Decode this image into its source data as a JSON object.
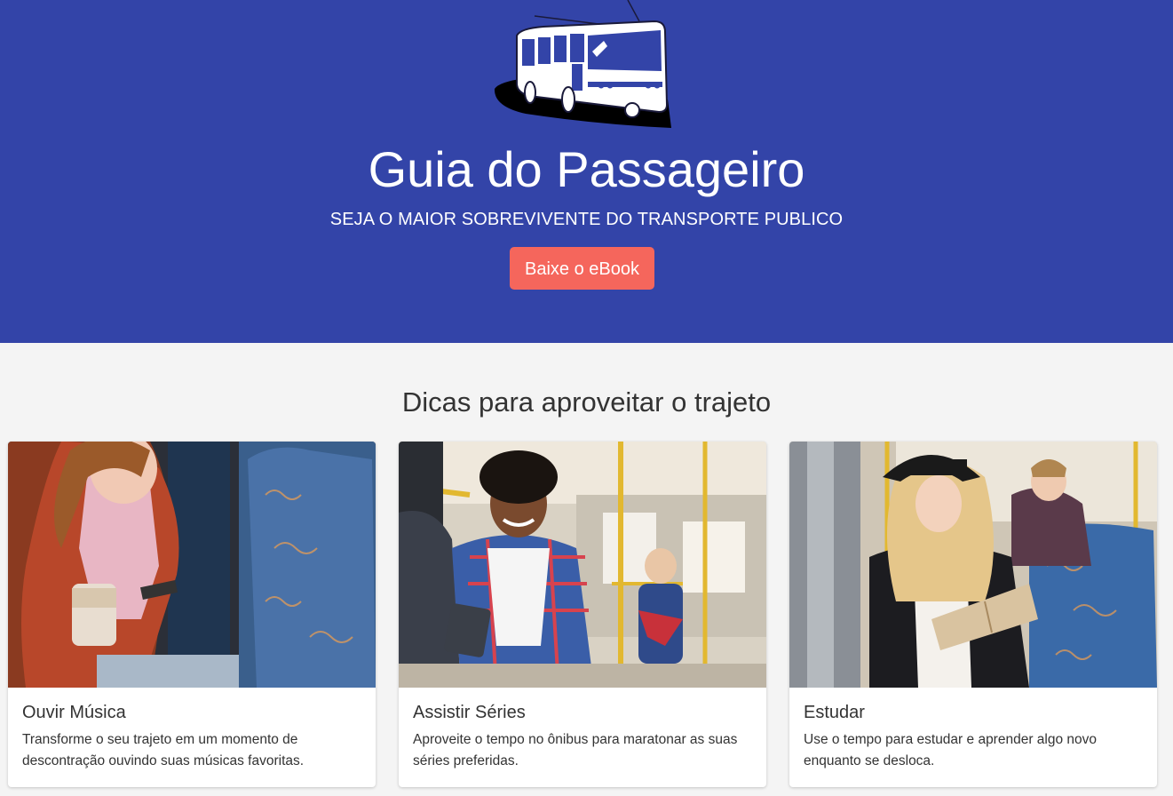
{
  "hero": {
    "title": "Guia do Passageiro",
    "subtitle": "SEJA O MAIOR SOBREVIVENTE DO TRANSPORTE PUBLICO",
    "cta_label": "Baixe o eBook",
    "bg_color": "#3344a8",
    "cta_color": "#f5665c",
    "logo_icon": "bus-icon"
  },
  "tips": {
    "heading": "Dicas para aproveitar o trajeto",
    "cards": [
      {
        "title": "Ouvir Música",
        "text": "Transforme o seu trajeto em um momento de descontração ouvindo suas músicas favoritas.",
        "image": "woman-with-headphones-and-coffee-photo"
      },
      {
        "title": "Assistir Séries",
        "text": "Aproveite o tempo no ônibus para maratonar as suas séries preferidas.",
        "image": "man-smiling-with-tablet-photo"
      },
      {
        "title": "Estudar",
        "text": "Use o tempo para estudar e aprender algo novo enquanto se desloca.",
        "image": "woman-reading-book-photo"
      }
    ]
  }
}
